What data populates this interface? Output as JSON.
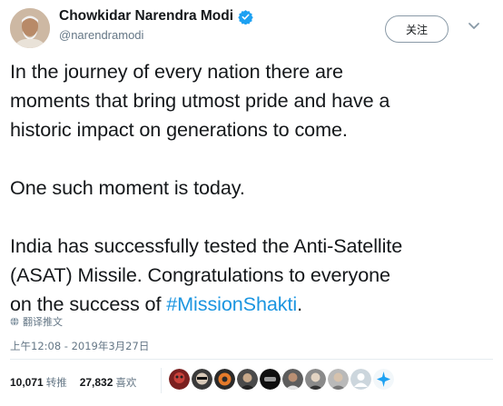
{
  "author": {
    "display_name": "Chowkidar Narendra Modi",
    "handle": "@narendramodi",
    "verified": true
  },
  "follow_button": {
    "label": "关注"
  },
  "tweet": {
    "lines": [
      "In the journey of every nation there are",
      "moments that bring utmost pride and have a",
      "historic impact on generations to come.",
      "One such moment is today.",
      "India has successfully tested the Anti-Satellite",
      "(ASAT) Missile. Congratulations to everyone",
      "on the success of "
    ],
    "hashtag": "#MissionShakti",
    "after_hashtag": "."
  },
  "translate_label": "翻译推文",
  "timestamp": "上午12:08 - 2019年3月27日",
  "stats": {
    "retweets_count": "10,071",
    "retweets_label": "转推",
    "likes_count": "27,832",
    "likes_label": "喜欢"
  },
  "likers_count": 10,
  "colors": {
    "link": "#1b95e0",
    "verified": "#1da1f2",
    "secondary_text": "#657786",
    "divider": "#e6ecf0"
  }
}
